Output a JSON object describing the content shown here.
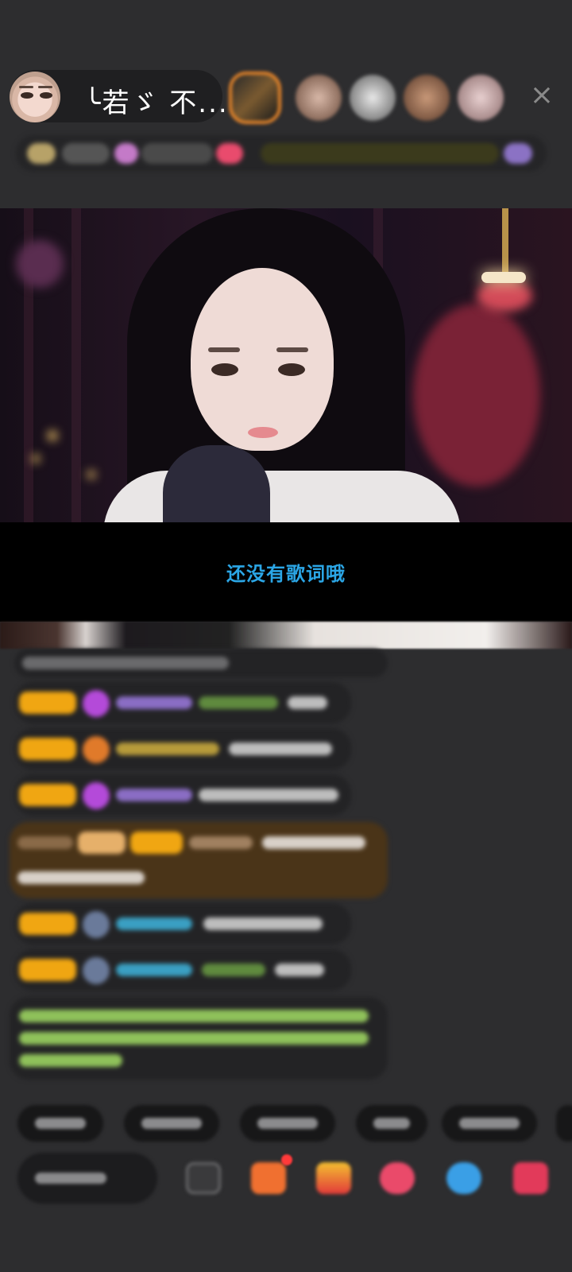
{
  "header": {
    "host_name": "╰若ゞ 不...",
    "close_icon": "×"
  },
  "lyrics": {
    "text": "还没有歌词哦"
  },
  "colors": {
    "lyrics_text": "#2ba6e6",
    "level_badge": "#f0a612",
    "background": "#2d2d2f",
    "highlight_message": "#4a3418",
    "green_notice_text": "#8fc15a"
  },
  "icons": {
    "close": "close-icon",
    "gem": "gem-icon",
    "gift": "gift-icon",
    "emoji": "emoji-icon",
    "share": "share-icon"
  }
}
